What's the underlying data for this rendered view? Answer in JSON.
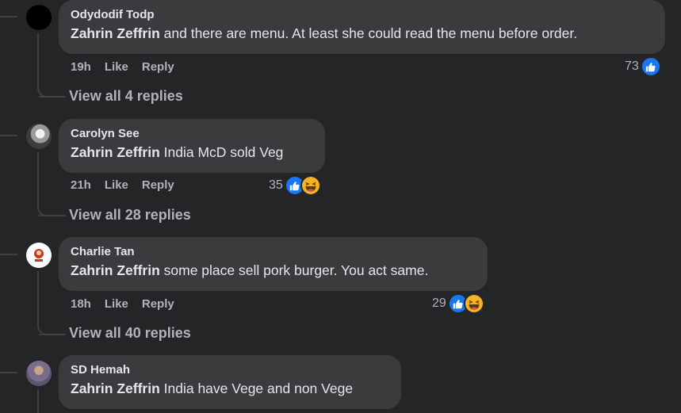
{
  "comments": [
    {
      "author": "Odydodif Todp",
      "mention": "Zahrin Zeffrin",
      "text": " and there are menu. At least she could read the menu before order.",
      "time": "19h",
      "like_label": "Like",
      "reply_label": "Reply",
      "reaction_count": "73",
      "reactions": [
        "like"
      ],
      "view_replies": "View all 4 replies"
    },
    {
      "author": "Carolyn See",
      "mention": "Zahrin Zeffrin",
      "text": " India McD sold Veg",
      "time": "21h",
      "like_label": "Like",
      "reply_label": "Reply",
      "reaction_count": "35",
      "reactions": [
        "like",
        "haha"
      ],
      "view_replies": "View all 28 replies"
    },
    {
      "author": "Charlie Tan",
      "mention": "Zahrin Zeffrin",
      "text": " some place sell pork burger. You act same.",
      "time": "18h",
      "like_label": "Like",
      "reply_label": "Reply",
      "reaction_count": "29",
      "reactions": [
        "like",
        "haha"
      ],
      "view_replies": "View all 40 replies"
    },
    {
      "author": "SD Hemah",
      "mention": "Zahrin Zeffrin",
      "text": " India have Vege and non Vege"
    }
  ],
  "colors": {
    "background": "#242526",
    "bubble": "#3a3b3c",
    "like_blue": "#1877f2",
    "secondary_text": "#b0b3b8"
  }
}
